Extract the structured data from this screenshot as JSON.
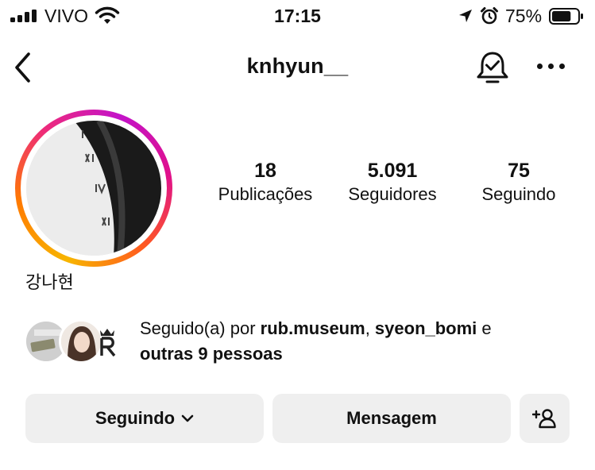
{
  "status_bar": {
    "carrier": "VIVO",
    "time": "17:15",
    "battery": "75%",
    "battery_level": 0.75
  },
  "header": {
    "username": "knhyun__"
  },
  "profile": {
    "display_name": "강나현",
    "stats": [
      {
        "value": "18",
        "label": "Publicações"
      },
      {
        "value": "5.091",
        "label": "Seguidores"
      },
      {
        "value": "75",
        "label": "Seguindo"
      }
    ]
  },
  "followed_by": {
    "prefix": "Seguido(a) por ",
    "user1": "rub.museum",
    "sep": ", ",
    "user2": "syeon_bomi",
    "conj": " e",
    "others": "outras 9 pessoas"
  },
  "buttons": {
    "following": "Seguindo",
    "message": "Mensagem"
  },
  "colors": {
    "button_bg": "#efefef",
    "story_ring": [
      "#f7b500",
      "#ff7a00",
      "#ee2a7b",
      "#c313c9"
    ]
  },
  "icons": [
    "signal-icon",
    "wifi-icon",
    "location-icon",
    "alarm-icon",
    "battery-icon",
    "back-icon",
    "bell-check-icon",
    "more-icon",
    "chevron-down-icon",
    "add-user-icon"
  ]
}
